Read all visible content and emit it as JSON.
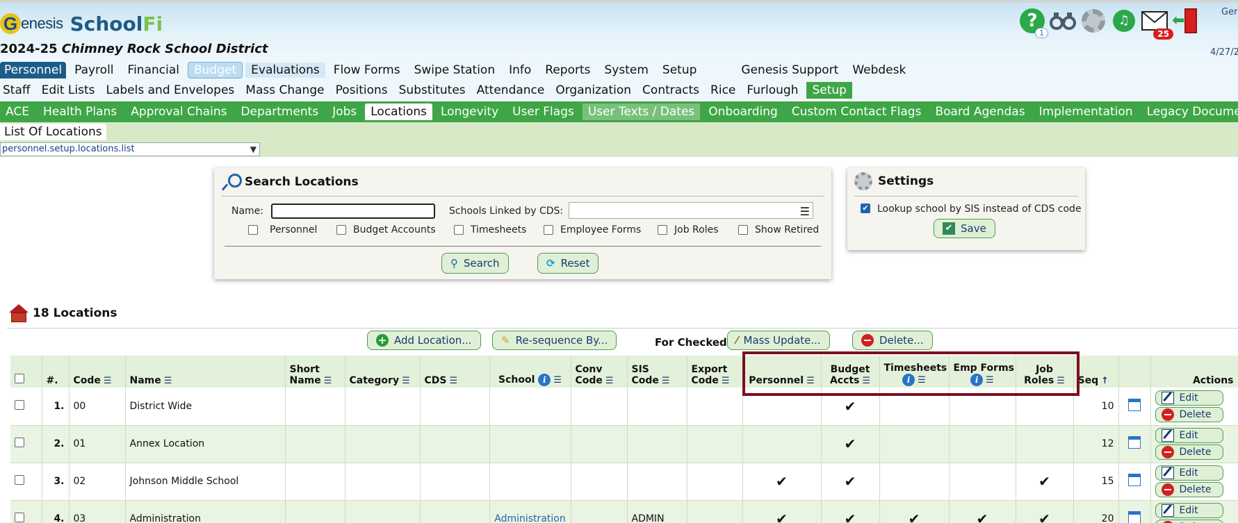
{
  "header": {
    "logo": {
      "genesis": "enesis",
      "g": "G",
      "school": "School",
      "fi": "Fi"
    },
    "district_year": "2024-25",
    "district_name": "Chimney Rock School District",
    "help_badge": "1",
    "mail_badge": "25",
    "user_text": "Ger",
    "date_text": "4/27/2"
  },
  "menu1": [
    "Personnel",
    "Payroll",
    "Financial",
    "Budget",
    "Evaluations",
    "Flow Forms",
    "Swipe Station",
    "Info",
    "Reports",
    "System",
    "Setup",
    "Genesis Support",
    "Webdesk"
  ],
  "menu2": [
    "Staff",
    "Edit Lists",
    "Labels and Envelopes",
    "Mass Change",
    "Positions",
    "Substitutes",
    "Attendance",
    "Organization",
    "Contracts",
    "Rice",
    "Furlough",
    "Setup"
  ],
  "menu3": [
    "ACE",
    "Health Plans",
    "Approval Chains",
    "Departments",
    "Jobs",
    "Locations",
    "Longevity",
    "User Flags",
    "User Texts / Dates",
    "Onboarding",
    "Custom Contact Flags",
    "Board Agendas",
    "Implementation",
    "Legacy Document"
  ],
  "page_tab": "List Of Locations",
  "path_select": "personnel.setup.locations.list",
  "search": {
    "title": "Search Locations",
    "name_label": "Name:",
    "name_value": "",
    "cds_label": "Schools Linked by CDS:",
    "cds_value": "",
    "checkboxes": [
      "Personnel",
      "Budget Accounts",
      "Timesheets",
      "Employee Forms",
      "Job Roles",
      "Show Retired"
    ],
    "search_btn": "Search",
    "reset_btn": "Reset"
  },
  "settings": {
    "title": "Settings",
    "lookup_label": "Lookup school by SIS instead of CDS code",
    "lookup_checked": true,
    "save_btn": "Save"
  },
  "locations": {
    "heading": "18 Locations",
    "add_btn": "Add Location...",
    "reseq_btn": "Re-sequence By...",
    "for_checked": "For Checked:",
    "mass_update_btn": "Mass Update...",
    "delete_btn": "Delete..."
  },
  "table": {
    "columns": {
      "num": "#.",
      "code": "Code",
      "name": "Name",
      "short_name_1": "Short",
      "short_name_2": "Name",
      "category": "Category",
      "cds": "CDS",
      "school": "School",
      "conv_1": "Conv",
      "conv_2": "Code",
      "sis_1": "SIS",
      "sis_2": "Code",
      "export_1": "Export",
      "export_2": "Code",
      "personnel": "Personnel",
      "budget_1": "Budget",
      "budget_2": "Accts",
      "timesheets": "Timesheets",
      "empforms": "Emp Forms",
      "jobroles_1": "Job",
      "jobroles_2": "Roles",
      "seq": "Seq",
      "actions": "Actions"
    },
    "edit_label": "Edit",
    "delete_label": "Delete",
    "rows": [
      {
        "num": "1.",
        "code": "00",
        "name": "District Wide",
        "short": "",
        "category": "",
        "cds": "",
        "school": "",
        "conv": "",
        "sis": "",
        "export": "",
        "personnel": "",
        "budget": "✔",
        "timesheets": "",
        "empforms": "",
        "jobroles": "",
        "seq": "10"
      },
      {
        "num": "2.",
        "code": "01",
        "name": "Annex Location",
        "short": "",
        "category": "",
        "cds": "",
        "school": "",
        "conv": "",
        "sis": "",
        "export": "",
        "personnel": "",
        "budget": "✔",
        "timesheets": "",
        "empforms": "",
        "jobroles": "",
        "seq": "12"
      },
      {
        "num": "3.",
        "code": "02",
        "name": "Johnson Middle School",
        "short": "",
        "category": "",
        "cds": "",
        "school": "",
        "conv": "",
        "sis": "",
        "export": "",
        "personnel": "✔",
        "budget": "✔",
        "timesheets": "",
        "empforms": "",
        "jobroles": "✔",
        "seq": "15"
      },
      {
        "num": "4.",
        "code": "03",
        "name": "Administration",
        "short": "",
        "category": "",
        "cds": "",
        "school": "Administration",
        "conv": "",
        "sis": "ADMIN",
        "export": "",
        "personnel": "✔",
        "budget": "✔",
        "timesheets": "✔",
        "empforms": "✔",
        "jobroles": "✔",
        "seq": "20"
      }
    ]
  },
  "colors": {
    "accent_green": "#3ea646",
    "nav_blue": "#1c5c88",
    "highlight": "#7a1020"
  }
}
